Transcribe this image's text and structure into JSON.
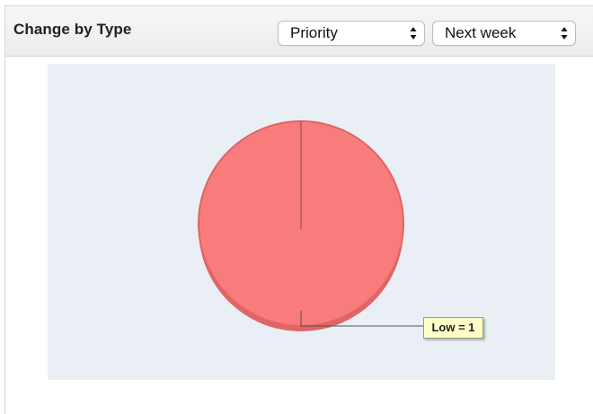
{
  "widget": {
    "title": "Change by Type",
    "group_select": {
      "value": "Priority"
    },
    "range_select": {
      "value": "Next week"
    }
  },
  "colors": {
    "slice_fill": "#f87c7c",
    "slice_edge": "#e06565",
    "chart_background": "#e9eff5",
    "tooltip_background": "#ffffc8"
  },
  "chart_data": {
    "type": "pie",
    "categories": [
      "Low"
    ],
    "values": [
      1
    ],
    "data_labels": [
      "Low = 1"
    ],
    "title": "",
    "legend": "none"
  }
}
